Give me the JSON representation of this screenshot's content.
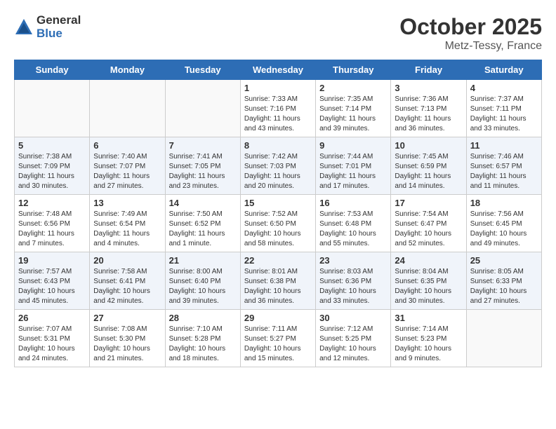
{
  "header": {
    "logo_general": "General",
    "logo_blue": "Blue",
    "month": "October 2025",
    "location": "Metz-Tessy, France"
  },
  "days_of_week": [
    "Sunday",
    "Monday",
    "Tuesday",
    "Wednesday",
    "Thursday",
    "Friday",
    "Saturday"
  ],
  "weeks": [
    [
      {
        "day": "",
        "info": ""
      },
      {
        "day": "",
        "info": ""
      },
      {
        "day": "",
        "info": ""
      },
      {
        "day": "1",
        "info": "Sunrise: 7:33 AM\nSunset: 7:16 PM\nDaylight: 11 hours\nand 43 minutes."
      },
      {
        "day": "2",
        "info": "Sunrise: 7:35 AM\nSunset: 7:14 PM\nDaylight: 11 hours\nand 39 minutes."
      },
      {
        "day": "3",
        "info": "Sunrise: 7:36 AM\nSunset: 7:13 PM\nDaylight: 11 hours\nand 36 minutes."
      },
      {
        "day": "4",
        "info": "Sunrise: 7:37 AM\nSunset: 7:11 PM\nDaylight: 11 hours\nand 33 minutes."
      }
    ],
    [
      {
        "day": "5",
        "info": "Sunrise: 7:38 AM\nSunset: 7:09 PM\nDaylight: 11 hours\nand 30 minutes."
      },
      {
        "day": "6",
        "info": "Sunrise: 7:40 AM\nSunset: 7:07 PM\nDaylight: 11 hours\nand 27 minutes."
      },
      {
        "day": "7",
        "info": "Sunrise: 7:41 AM\nSunset: 7:05 PM\nDaylight: 11 hours\nand 23 minutes."
      },
      {
        "day": "8",
        "info": "Sunrise: 7:42 AM\nSunset: 7:03 PM\nDaylight: 11 hours\nand 20 minutes."
      },
      {
        "day": "9",
        "info": "Sunrise: 7:44 AM\nSunset: 7:01 PM\nDaylight: 11 hours\nand 17 minutes."
      },
      {
        "day": "10",
        "info": "Sunrise: 7:45 AM\nSunset: 6:59 PM\nDaylight: 11 hours\nand 14 minutes."
      },
      {
        "day": "11",
        "info": "Sunrise: 7:46 AM\nSunset: 6:57 PM\nDaylight: 11 hours\nand 11 minutes."
      }
    ],
    [
      {
        "day": "12",
        "info": "Sunrise: 7:48 AM\nSunset: 6:56 PM\nDaylight: 11 hours\nand 7 minutes."
      },
      {
        "day": "13",
        "info": "Sunrise: 7:49 AM\nSunset: 6:54 PM\nDaylight: 11 hours\nand 4 minutes."
      },
      {
        "day": "14",
        "info": "Sunrise: 7:50 AM\nSunset: 6:52 PM\nDaylight: 11 hours\nand 1 minute."
      },
      {
        "day": "15",
        "info": "Sunrise: 7:52 AM\nSunset: 6:50 PM\nDaylight: 10 hours\nand 58 minutes."
      },
      {
        "day": "16",
        "info": "Sunrise: 7:53 AM\nSunset: 6:48 PM\nDaylight: 10 hours\nand 55 minutes."
      },
      {
        "day": "17",
        "info": "Sunrise: 7:54 AM\nSunset: 6:47 PM\nDaylight: 10 hours\nand 52 minutes."
      },
      {
        "day": "18",
        "info": "Sunrise: 7:56 AM\nSunset: 6:45 PM\nDaylight: 10 hours\nand 49 minutes."
      }
    ],
    [
      {
        "day": "19",
        "info": "Sunrise: 7:57 AM\nSunset: 6:43 PM\nDaylight: 10 hours\nand 45 minutes."
      },
      {
        "day": "20",
        "info": "Sunrise: 7:58 AM\nSunset: 6:41 PM\nDaylight: 10 hours\nand 42 minutes."
      },
      {
        "day": "21",
        "info": "Sunrise: 8:00 AM\nSunset: 6:40 PM\nDaylight: 10 hours\nand 39 minutes."
      },
      {
        "day": "22",
        "info": "Sunrise: 8:01 AM\nSunset: 6:38 PM\nDaylight: 10 hours\nand 36 minutes."
      },
      {
        "day": "23",
        "info": "Sunrise: 8:03 AM\nSunset: 6:36 PM\nDaylight: 10 hours\nand 33 minutes."
      },
      {
        "day": "24",
        "info": "Sunrise: 8:04 AM\nSunset: 6:35 PM\nDaylight: 10 hours\nand 30 minutes."
      },
      {
        "day": "25",
        "info": "Sunrise: 8:05 AM\nSunset: 6:33 PM\nDaylight: 10 hours\nand 27 minutes."
      }
    ],
    [
      {
        "day": "26",
        "info": "Sunrise: 7:07 AM\nSunset: 5:31 PM\nDaylight: 10 hours\nand 24 minutes."
      },
      {
        "day": "27",
        "info": "Sunrise: 7:08 AM\nSunset: 5:30 PM\nDaylight: 10 hours\nand 21 minutes."
      },
      {
        "day": "28",
        "info": "Sunrise: 7:10 AM\nSunset: 5:28 PM\nDaylight: 10 hours\nand 18 minutes."
      },
      {
        "day": "29",
        "info": "Sunrise: 7:11 AM\nSunset: 5:27 PM\nDaylight: 10 hours\nand 15 minutes."
      },
      {
        "day": "30",
        "info": "Sunrise: 7:12 AM\nSunset: 5:25 PM\nDaylight: 10 hours\nand 12 minutes."
      },
      {
        "day": "31",
        "info": "Sunrise: 7:14 AM\nSunset: 5:23 PM\nDaylight: 10 hours\nand 9 minutes."
      },
      {
        "day": "",
        "info": ""
      }
    ]
  ]
}
